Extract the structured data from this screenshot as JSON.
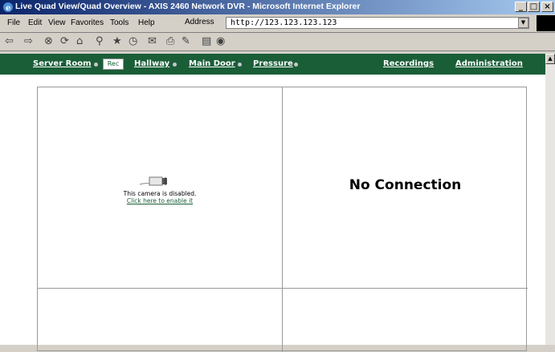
{
  "window": {
    "title": "Live Quad View/Quad Overview - AXIS 2460 Network DVR - Microsoft Internet Explorer"
  },
  "menu": [
    "File",
    "Edit",
    "View",
    "Favorites",
    "Tools",
    "Help"
  ],
  "address": {
    "label": "Address",
    "value": "http://123.123.123.123"
  },
  "nav": {
    "cameras": [
      {
        "label": "Server Room"
      },
      {
        "label": "Hallway"
      },
      {
        "label": "Main Door"
      },
      {
        "label": "Pressure"
      }
    ],
    "rec_label": "Rec",
    "recordings": "Recordings",
    "administration": "Administration",
    "bar_color": "#1a5e38"
  },
  "quad": {
    "cell1": {
      "disabled_text": "This camera is disabled.",
      "enable_link": "Click here to enable it"
    },
    "cell2": {
      "status": "No Connection"
    }
  }
}
